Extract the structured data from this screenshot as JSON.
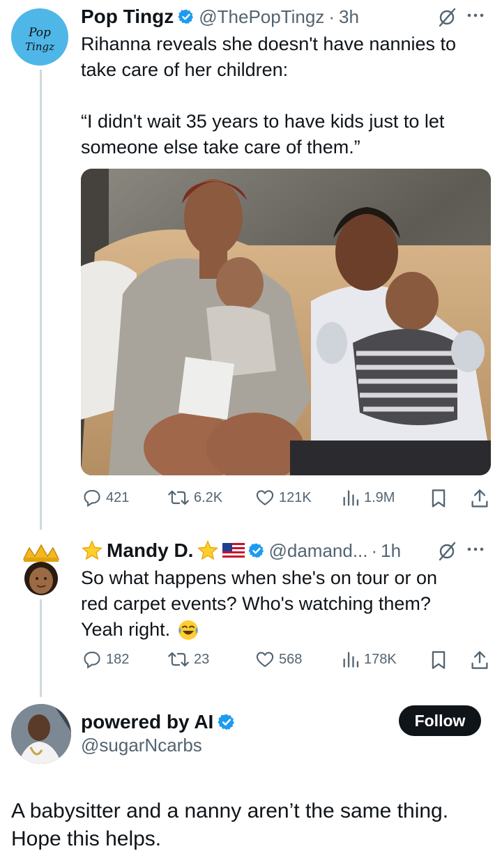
{
  "tweet1": {
    "avatar_text": "Pop Tingz",
    "name": "Pop Tingz",
    "handle": "@ThePopTingz",
    "sep": "·",
    "time": "3h",
    "text_line1": "Rihanna reveals she doesn't have nannies to",
    "text_line2": "take care of her children:",
    "quote_line1": "“I didn't wait 35 years to have kids just to let",
    "quote_line2": "someone else take care of them.”",
    "replies": "421",
    "retweets": "6.2K",
    "likes": "121K",
    "views": "1.9M"
  },
  "tweet2": {
    "name": "Mandy D.",
    "handle": "@damand...",
    "sep": "·",
    "time": "1h",
    "text_line1": "So what happens when she's on tour or on",
    "text_line2": "red carpet events? Who's watching them?",
    "text_line3": "Yeah right.",
    "replies": "182",
    "retweets": "23",
    "likes": "568",
    "views": "178K"
  },
  "tweet3": {
    "name": "powered by AI",
    "handle": "@sugarNcarbs",
    "follow_label": "Follow",
    "text_line1": "A babysitter and a nanny aren’t the same thing.",
    "text_line2": "Hope this helps."
  },
  "icons": {
    "verified": "verified-badge-icon",
    "grok": "grok-icon",
    "more": "more-options-icon",
    "reply": "reply-icon",
    "retweet": "retweet-icon",
    "like": "like-icon",
    "views": "views-icon",
    "bookmark": "bookmark-icon",
    "share": "share-icon"
  },
  "colors": {
    "verified": "#1d9bf0",
    "text": "#0f1419",
    "muted": "#536471",
    "avatar_bg": "#4fb6e8"
  }
}
